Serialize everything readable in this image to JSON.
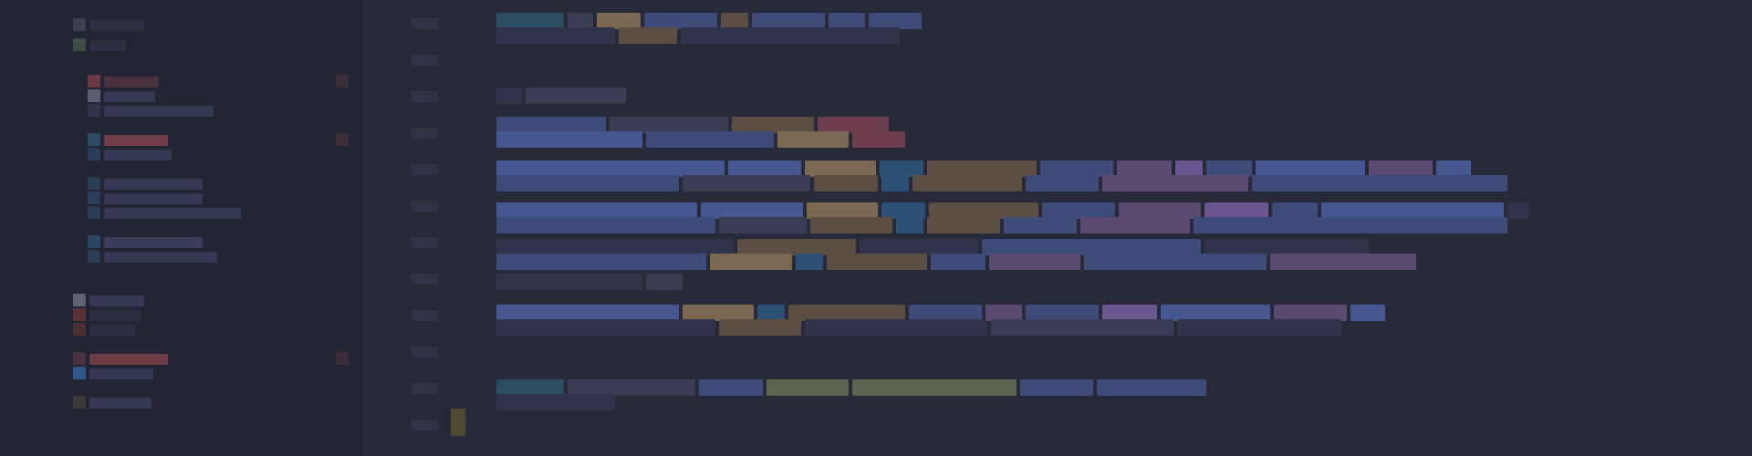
{
  "window": {
    "title": ""
  },
  "sidebar": {
    "rows": [
      {
        "icon": "folder-icon",
        "color": "#3d3e50"
      },
      {
        "icon": "folder-icon",
        "color": "#3f4d45"
      },
      {
        "icon": "file-icon",
        "color": "#6b3941"
      },
      {
        "icon": "file-icon",
        "color": "#5a6072"
      },
      {
        "icon": "file-icon",
        "color": "#30354c"
      },
      {
        "icon": "file-icon",
        "color": "#6f3c47"
      },
      {
        "icon": "file-icon",
        "color": "#2d4a62"
      },
      {
        "icon": "file-icon",
        "color": "#2b3e58"
      },
      {
        "icon": "file-icon",
        "color": "#2a3e55"
      },
      {
        "icon": "file-icon",
        "color": "#2c4463"
      },
      {
        "icon": "file-icon",
        "color": "#2a3e55"
      },
      {
        "icon": "file-icon",
        "color": "#616374"
      },
      {
        "icon": "file-icon",
        "color": "#5b3336"
      },
      {
        "icon": "file-icon",
        "color": "#4d3033"
      },
      {
        "icon": "file-icon",
        "color": "#6e3c45"
      },
      {
        "icon": "file-icon",
        "color": "#2f5888"
      },
      {
        "icon": "file-icon",
        "color": "#3c3a38"
      }
    ]
  },
  "editor": {
    "line_count": 19
  },
  "colors": {
    "background": "#282a39",
    "sidebar": "#232535",
    "gutter": "#272939",
    "accent_blue": "#465891",
    "accent_gold": "#7b6852",
    "accent_purple": "#6b5690"
  }
}
